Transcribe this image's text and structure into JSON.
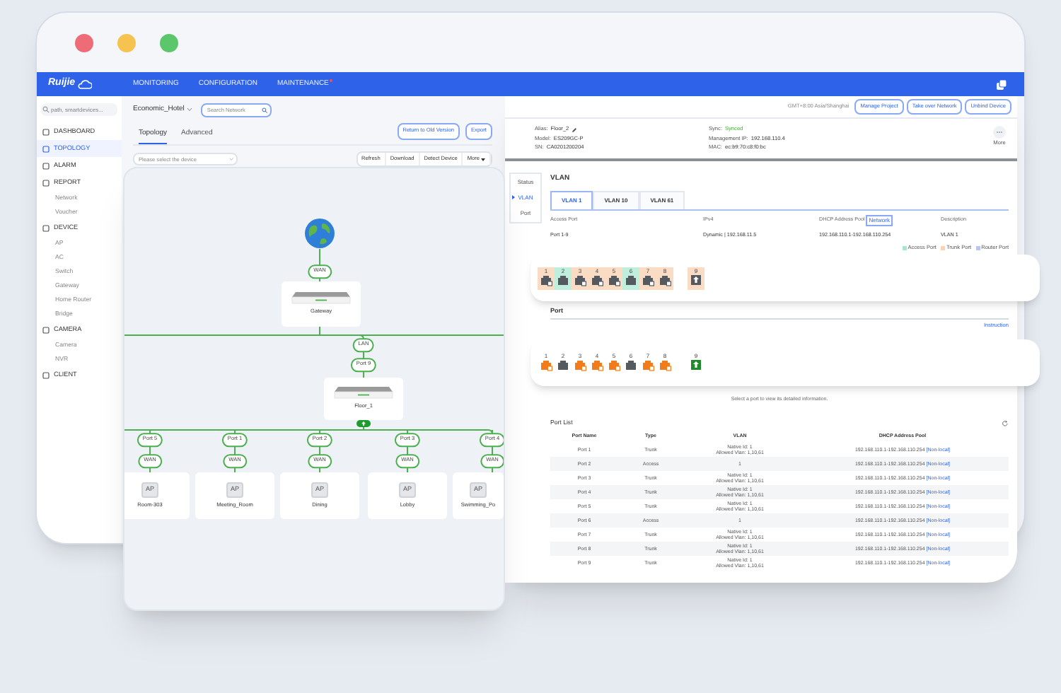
{
  "nav": {
    "logo": "Ruijie",
    "items": [
      {
        "label": "MONITORING",
        "selected": false,
        "alert": false
      },
      {
        "label": "CONFIGURATION",
        "selected": false,
        "alert": false
      },
      {
        "label": "MAINTENANCE",
        "selected": false,
        "alert": true
      }
    ]
  },
  "sidebar": {
    "search": {
      "placeholder": "path, smartdevices..."
    },
    "items": [
      {
        "label": "DASHBOARD",
        "selected": false
      },
      {
        "label": "TOPOLOGY",
        "selected": true
      },
      {
        "label": "ALARM",
        "selected": false
      },
      {
        "label": "REPORT",
        "selected": false,
        "children": [
          {
            "label": "Network",
            "selected": false
          },
          {
            "label": "Voucher",
            "selected": false
          }
        ]
      },
      {
        "label": "DEVICE",
        "selected": false,
        "children": [
          {
            "label": "AP",
            "selected": false
          },
          {
            "label": "AC",
            "selected": false
          },
          {
            "label": "Switch",
            "selected": false
          },
          {
            "label": "Gateway",
            "selected": false
          },
          {
            "label": "Home Router",
            "selected": false
          },
          {
            "label": "Bridge",
            "selected": false
          }
        ]
      },
      {
        "label": "CAMERA",
        "selected": false,
        "children": [
          {
            "label": "Camera",
            "selected": false
          },
          {
            "label": "NVR",
            "selected": false
          }
        ]
      },
      {
        "label": "CLIENT",
        "selected": false
      }
    ]
  },
  "project": {
    "network": "Economic_Hotel",
    "search": {
      "placeholder": "Search Network"
    }
  },
  "tabs": [
    {
      "label": "Topology",
      "selected": true
    },
    {
      "label": "Advanced",
      "selected": false
    }
  ],
  "top_buttons": [
    "Return to Old Version",
    "Export"
  ],
  "device_select": {
    "placeholder": "Please select the device"
  },
  "toolbar": [
    {
      "label": "Refresh",
      "kind": "plain"
    },
    {
      "label": "Download",
      "kind": "plain"
    },
    {
      "label": "Detect Device",
      "kind": "plain"
    },
    {
      "label": "More",
      "kind": "menu"
    }
  ],
  "topology": {
    "gateway": {
      "uplink_label": "WAN",
      "name": "Gateway"
    },
    "lan_label": "LAN",
    "switch": {
      "port_label": "Port 9",
      "name": "Floor_1"
    },
    "access_points": [
      {
        "port_label": "Port 5",
        "uplink_label": "WAN",
        "model": "AP",
        "name": "Room-303"
      },
      {
        "port_label": "Port 1",
        "uplink_label": "WAN",
        "model": "AP",
        "name": "Meeting_Room"
      },
      {
        "port_label": "Port 2",
        "uplink_label": "WAN",
        "model": "AP",
        "name": "Dining"
      },
      {
        "port_label": "Port 3",
        "uplink_label": "WAN",
        "model": "AP",
        "name": "Lobby"
      },
      {
        "port_label": "Port 4",
        "uplink_label": "WAN",
        "model": "AP",
        "name": "Swimming_Po"
      }
    ]
  },
  "header": {
    "timezone": "GMT+8:00 Asia/Shanghai",
    "buttons": [
      "Manage Project",
      "Take over Network",
      "Unbind Device"
    ]
  },
  "device": {
    "columns": [
      [
        {
          "label": "Alias:",
          "value": "Floor_2",
          "kind": "editable"
        },
        {
          "label": "Model:",
          "value": "ES209GC-P",
          "kind": "plain"
        },
        {
          "label": "SN:",
          "value": "CA0201200204",
          "kind": "plain"
        }
      ],
      [
        {
          "label": "Sync:",
          "value": "Synced",
          "kind": "status"
        },
        {
          "label": "Management IP:",
          "value": "192.168.110.4",
          "kind": "plain"
        },
        {
          "label": "MAC:",
          "value": "ec:b9:70:c8:f0:bc",
          "kind": "plain"
        }
      ]
    ],
    "more": "More"
  },
  "side_tabs": [
    {
      "label": "Status",
      "selected": false
    },
    {
      "label": "VLAN",
      "selected": true
    },
    {
      "label": "Port",
      "selected": false
    }
  ],
  "vlan": {
    "title": "VLAN",
    "tabs": [
      {
        "label": "VLAN 1",
        "selected": true
      },
      {
        "label": "VLAN 10",
        "selected": false
      },
      {
        "label": "VLAN 61",
        "selected": false
      }
    ],
    "columns": [
      "Access Port",
      "IPv4",
      "DHCP Address Pool",
      "Description"
    ],
    "pool_tag": "Network",
    "row": [
      "Port 1-9",
      "Dynamic | 192.168.11.5",
      "192.168.110.1-192.168.110.254",
      "VLAN 1"
    ],
    "legend": [
      {
        "label": "Access Port",
        "color": "#a8e6cf"
      },
      {
        "label": "Trunk Port",
        "color": "#f9d3b4"
      },
      {
        "label": "Router Port",
        "color": "#b9c6ef"
      }
    ],
    "ports": [
      {
        "number": "1",
        "kind": "trunk"
      },
      {
        "number": "2",
        "kind": "access"
      },
      {
        "number": "3",
        "kind": "trunk"
      },
      {
        "number": "4",
        "kind": "trunk"
      },
      {
        "number": "5",
        "kind": "trunk"
      },
      {
        "number": "6",
        "kind": "access"
      },
      {
        "number": "7",
        "kind": "trunk"
      },
      {
        "number": "8",
        "kind": "trunk"
      },
      {
        "number": "9",
        "kind": "uplink"
      }
    ]
  },
  "port": {
    "title": "Port",
    "link": "Instruction",
    "ports": [
      {
        "number": "1",
        "kind": "trunk",
        "connected": true
      },
      {
        "number": "2",
        "kind": "access",
        "connected": false
      },
      {
        "number": "3",
        "kind": "trunk",
        "connected": true
      },
      {
        "number": "4",
        "kind": "trunk",
        "connected": true
      },
      {
        "number": "5",
        "kind": "trunk",
        "connected": true
      },
      {
        "number": "6",
        "kind": "access",
        "connected": false
      },
      {
        "number": "7",
        "kind": "trunk",
        "connected": true
      },
      {
        "number": "8",
        "kind": "trunk",
        "connected": true
      },
      {
        "number": "9",
        "kind": "uplink",
        "connected": true
      }
    ],
    "hint": "Select a port to view its detailed information.",
    "list_title": "Port List",
    "columns": [
      "Port Name",
      "Type",
      "VLAN",
      "DHCP Address Pool"
    ],
    "rows": [
      {
        "name": "Port 1",
        "type": "Trunk",
        "vlan": [
          "Native Id: 1",
          "Allowed Vlan: 1,10,61"
        ],
        "pool": "192.168.110.1-192.168.110.254",
        "tag": "[Non-local]"
      },
      {
        "name": "Port 2",
        "type": "Access",
        "vlan": [
          "1"
        ],
        "pool": "192.168.110.1-192.168.110.254",
        "tag": "[Non-local]"
      },
      {
        "name": "Port 3",
        "type": "Trunk",
        "vlan": [
          "Native Id: 1",
          "Allowed Vlan: 1,10,61"
        ],
        "pool": "192.168.110.1-192.168.110.254",
        "tag": "[Non-local]"
      },
      {
        "name": "Port 4",
        "type": "Trunk",
        "vlan": [
          "Native Id: 1",
          "Allowed Vlan: 1,10,61"
        ],
        "pool": "192.168.110.1-192.168.110.254",
        "tag": "[Non-local]"
      },
      {
        "name": "Port 5",
        "type": "Trunk",
        "vlan": [
          "Native Id: 1",
          "Allowed Vlan: 1,10,61"
        ],
        "pool": "192.168.110.1-192.168.110.254",
        "tag": "[Non-local]"
      },
      {
        "name": "Port 6",
        "type": "Access",
        "vlan": [
          "1"
        ],
        "pool": "192.168.110.1-192.168.110.254",
        "tag": "[Non-local]"
      },
      {
        "name": "Port 7",
        "type": "Trunk",
        "vlan": [
          "Native Id: 1",
          "Allowed Vlan: 1,10,61"
        ],
        "pool": "192.168.110.1-192.168.110.254",
        "tag": "[Non-local]"
      },
      {
        "name": "Port 8",
        "type": "Trunk",
        "vlan": [
          "Native Id: 1",
          "Allowed Vlan: 1,10,61"
        ],
        "pool": "192.168.110.1-192.168.110.254",
        "tag": "[Non-local]"
      },
      {
        "name": "Port 9",
        "type": "Trunk",
        "vlan": [
          "Native Id: 1",
          "Allowed Vlan: 1,10,61"
        ],
        "pool": "192.168.110.1-192.168.110.254",
        "tag": "[Non-local]"
      }
    ]
  }
}
